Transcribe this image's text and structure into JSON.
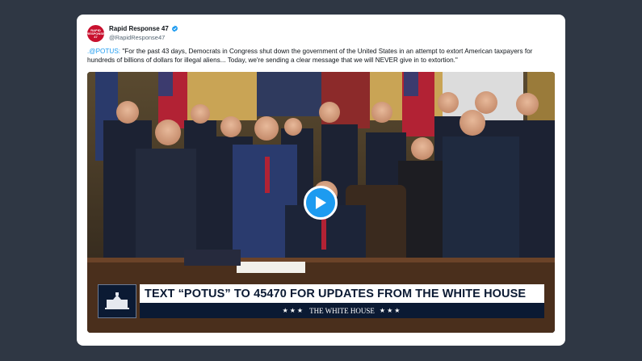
{
  "tweet": {
    "display_name": "Rapid Response 47",
    "handle": "@RapidResponse47",
    "avatar_text": "RAPID RESPONSE 47",
    "verified_icon": "verified-badge-icon",
    "mention": ".@POTUS:",
    "text": " \"For the past 43 days, Democrats in Congress shut down the government of the United States in an attempt to extort American taxpayers for hundreds of billions of dollars for illegal aliens... Today, we're sending a clear message that we will NEVER give in to extortion.\""
  },
  "video": {
    "play_icon": "play-icon",
    "lower_third": {
      "headline": "TEXT “POTUS” TO 45470 FOR UPDATES FROM THE WHITE HOUSE",
      "stars_left": "★★★",
      "subtitle": "THE WHITE HOUSE",
      "stars_right": "★★★"
    }
  },
  "colors": {
    "page_bg": "#2f3744",
    "accent": "#1d9bf0",
    "brand_red": "#c8102e",
    "lower_third_navy": "#0b1a33"
  }
}
